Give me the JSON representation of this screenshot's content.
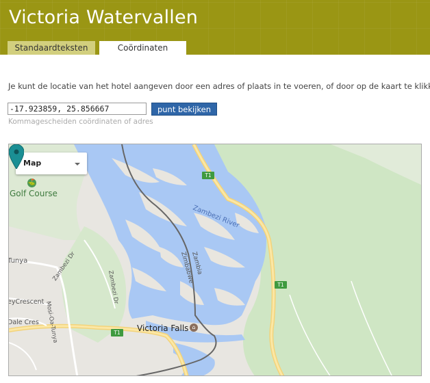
{
  "header": {
    "title": "Victoria Watervallen",
    "tabs": [
      {
        "label": "Standaardteksten",
        "active": false
      },
      {
        "label": "Coördinaten",
        "active": true
      }
    ]
  },
  "main": {
    "intro": "Je kunt de locatie van het hotel aangeven door een adres of plaats in te voeren, of door op de kaart te klikken.",
    "coord_value": "-17.923859, 25.856667",
    "view_button": "punt bekijken",
    "hint": "Kommagescheiden coördinaten of adres"
  },
  "map": {
    "type_selector": "Map",
    "labels": {
      "golf": "Golf Course",
      "tunya": "Tunya",
      "crescent": "eyCrescent",
      "dale": "Dale Cres",
      "victoria_falls": "Victoria Falls"
    },
    "road_labels": {
      "zambezi_river": "Zambezi River",
      "zimbabwe": "Zimbabwe",
      "zambia": "Zambia",
      "zambezi_dr_1": "Zambezi Dr",
      "zambezi_dr_2": "Zambezi Dr",
      "mosi": "Mosi-Oa-Tunya"
    },
    "shield": "T1",
    "colors": {
      "water": "#a9c8f4",
      "land": "#e9e6df",
      "park": "#cfe6c4",
      "pin": "#1a8f94"
    }
  }
}
